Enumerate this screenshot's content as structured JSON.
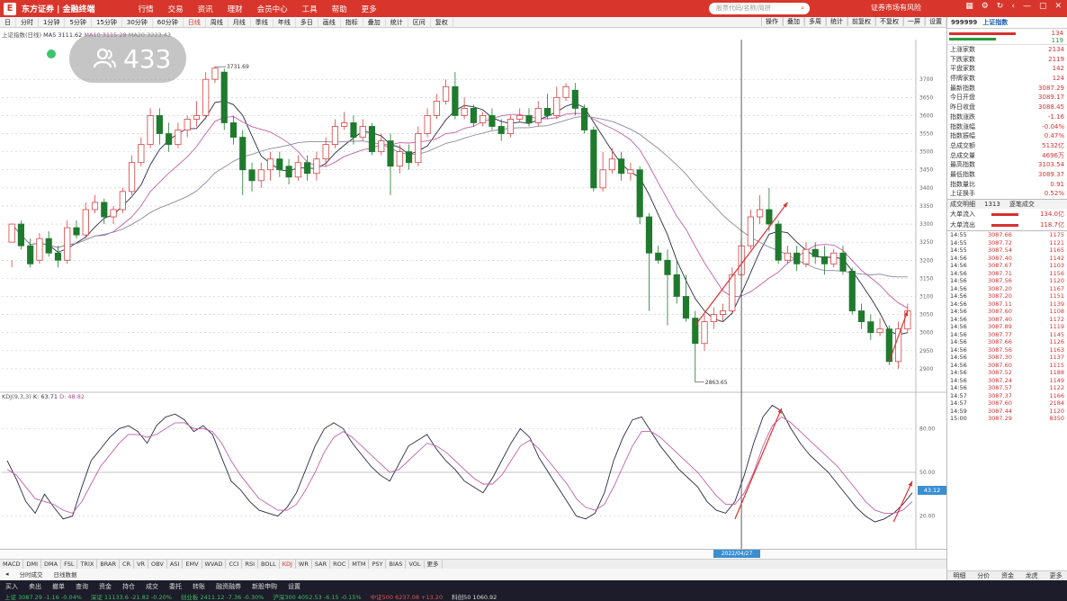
{
  "titlebar": {
    "logo": "E",
    "brand": "东方证券 | 金融终端",
    "menu": [
      "行情",
      "交易",
      "资讯",
      "理财",
      "会员中心",
      "工具",
      "帮助",
      "更多"
    ],
    "search_placeholder": "股票代码/名称/简拼",
    "market_note": "证券市场有风险",
    "icons": [
      "grid-icon",
      "settings-icon",
      "refresh-icon",
      "back-icon",
      "minimize-icon",
      "maximize-icon",
      "close-icon"
    ]
  },
  "toolbar": {
    "items": [
      "日",
      "分时",
      "1分钟",
      "5分钟",
      "15分钟",
      "30分钟",
      "60分钟",
      "日线",
      "周线",
      "月线",
      "季线",
      "年线",
      "多日",
      "画线",
      "指标",
      "叠加",
      "统计",
      "区间",
      "复权"
    ],
    "active_index": 7,
    "right": [
      "操作",
      "叠加",
      "多周",
      "统计",
      "前复权",
      "不复权",
      "一屏",
      "设置"
    ]
  },
  "infoline": {
    "name": "上证指数(日线)",
    "ma5": "MA5 3111.62",
    "ma10": "MA10 3115.28",
    "ma20": "MA20 3223.43"
  },
  "viewer": {
    "count": "433"
  },
  "chart_labels": {
    "high": "3731.69",
    "low": "2863.65"
  },
  "chart_data": {
    "type": "candlestick",
    "note": "price chart with KDJ subchart",
    "ylim": [
      2850,
      3800
    ],
    "yticks": [
      2900,
      2950,
      3000,
      3050,
      3100,
      3150,
      3200,
      3250,
      3300,
      3350,
      3400,
      3450,
      3500,
      3550,
      3600,
      3650,
      3700
    ],
    "candles": [
      [
        3250,
        3300,
        3200,
        3180
      ],
      [
        3300,
        3240,
        3310,
        3230
      ],
      [
        3240,
        3190,
        3260,
        3180
      ],
      [
        3200,
        3260,
        3275,
        3190
      ],
      [
        3260,
        3220,
        3280,
        3210
      ],
      [
        3220,
        3200,
        3240,
        3180
      ],
      [
        3200,
        3290,
        3310,
        3190
      ],
      [
        3290,
        3270,
        3310,
        3260
      ],
      [
        3270,
        3340,
        3360,
        3260
      ],
      [
        3340,
        3360,
        3380,
        3330
      ],
      [
        3360,
        3320,
        3370,
        3300
      ],
      [
        3320,
        3340,
        3350,
        3300
      ],
      [
        3340,
        3390,
        3400,
        3330
      ],
      [
        3390,
        3470,
        3490,
        3380
      ],
      [
        3470,
        3520,
        3540,
        3460
      ],
      [
        3520,
        3600,
        3620,
        3510
      ],
      [
        3600,
        3550,
        3620,
        3520
      ],
      [
        3550,
        3520,
        3580,
        3500
      ],
      [
        3520,
        3560,
        3580,
        3510
      ],
      [
        3560,
        3590,
        3600,
        3540
      ],
      [
        3590,
        3600,
        3640,
        3570
      ],
      [
        3600,
        3700,
        3720,
        3590
      ],
      [
        3700,
        3731,
        3735,
        3690
      ],
      [
        3720,
        3580,
        3730,
        3560
      ],
      [
        3580,
        3540,
        3600,
        3520
      ],
      [
        3540,
        3450,
        3560,
        3380
      ],
      [
        3450,
        3420,
        3470,
        3390
      ],
      [
        3420,
        3450,
        3470,
        3400
      ],
      [
        3450,
        3480,
        3500,
        3420
      ],
      [
        3480,
        3450,
        3500,
        3430
      ],
      [
        3460,
        3430,
        3480,
        3410
      ],
      [
        3430,
        3470,
        3490,
        3420
      ],
      [
        3470,
        3440,
        3490,
        3420
      ],
      [
        3440,
        3480,
        3500,
        3420
      ],
      [
        3480,
        3520,
        3540,
        3460
      ],
      [
        3520,
        3570,
        3590,
        3510
      ],
      [
        3570,
        3580,
        3610,
        3560
      ],
      [
        3580,
        3540,
        3600,
        3520
      ],
      [
        3540,
        3570,
        3590,
        3530
      ],
      [
        3570,
        3500,
        3580,
        3490
      ],
      [
        3500,
        3530,
        3550,
        3490
      ],
      [
        3530,
        3460,
        3550,
        3380
      ],
      [
        3460,
        3500,
        3520,
        3440
      ],
      [
        3500,
        3470,
        3520,
        3450
      ],
      [
        3470,
        3550,
        3570,
        3460
      ],
      [
        3550,
        3600,
        3620,
        3540
      ],
      [
        3600,
        3640,
        3660,
        3590
      ],
      [
        3640,
        3680,
        3700,
        3630
      ],
      [
        3680,
        3600,
        3720,
        3590
      ],
      [
        3600,
        3620,
        3650,
        3590
      ],
      [
        3620,
        3580,
        3630,
        3570
      ],
      [
        3580,
        3600,
        3610,
        3570
      ],
      [
        3600,
        3570,
        3620,
        3560
      ],
      [
        3570,
        3550,
        3590,
        3530
      ],
      [
        3550,
        3590,
        3600,
        3540
      ],
      [
        3590,
        3600,
        3620,
        3580
      ],
      [
        3600,
        3580,
        3620,
        3570
      ],
      [
        3580,
        3620,
        3640,
        3570
      ],
      [
        3620,
        3600,
        3660,
        3590
      ],
      [
        3600,
        3650,
        3680,
        3590
      ],
      [
        3650,
        3680,
        3690,
        3640
      ],
      [
        3670,
        3620,
        3690,
        3600
      ],
      [
        3620,
        3560,
        3630,
        3550
      ],
      [
        3560,
        3400,
        3570,
        3390
      ],
      [
        3400,
        3450,
        3500,
        3390
      ],
      [
        3450,
        3480,
        3510,
        3440
      ],
      [
        3480,
        3440,
        3500,
        3420
      ],
      [
        3440,
        3450,
        3470,
        3420
      ],
      [
        3450,
        3320,
        3460,
        3300
      ],
      [
        3320,
        3220,
        3330,
        3060
      ],
      [
        3220,
        3200,
        3240,
        3190
      ],
      [
        3200,
        3160,
        3230,
        3020
      ],
      [
        3160,
        3100,
        3200,
        3080
      ],
      [
        3100,
        3040,
        3160,
        3030
      ],
      [
        3040,
        2970,
        3060,
        2863
      ],
      [
        2970,
        3030,
        3050,
        2950
      ],
      [
        3030,
        3050,
        3070,
        3010
      ],
      [
        3050,
        3060,
        3080,
        3030
      ],
      [
        3060,
        3160,
        3180,
        3050
      ],
      [
        3160,
        3240,
        3260,
        3150
      ],
      [
        3240,
        3320,
        3340,
        3230
      ],
      [
        3320,
        3340,
        3380,
        3300
      ],
      [
        3340,
        3300,
        3400,
        3280
      ],
      [
        3300,
        3200,
        3310,
        3190
      ],
      [
        3200,
        3220,
        3240,
        3190
      ],
      [
        3220,
        3190,
        3240,
        3170
      ],
      [
        3190,
        3230,
        3250,
        3180
      ],
      [
        3230,
        3210,
        3250,
        3190
      ],
      [
        3210,
        3190,
        3240,
        3160
      ],
      [
        3190,
        3220,
        3230,
        3180
      ],
      [
        3220,
        3170,
        3240,
        3160
      ],
      [
        3170,
        3060,
        3180,
        3050
      ],
      [
        3060,
        3030,
        3080,
        3010
      ],
      [
        3030,
        3000,
        3050,
        2980
      ],
      [
        3000,
        3010,
        3040,
        2990
      ],
      [
        3010,
        2920,
        3020,
        2910
      ],
      [
        2920,
        3010,
        3030,
        2900
      ],
      [
        3010,
        3060,
        3080,
        3000
      ]
    ],
    "kdj_ylim": [
      0,
      100
    ],
    "kdj_yticks": [
      20,
      50,
      80
    ],
    "kdj_k": [
      58,
      45,
      30,
      22,
      35,
      26,
      18,
      20,
      40,
      58,
      66,
      74,
      80,
      82,
      78,
      70,
      82,
      88,
      90,
      86,
      78,
      82,
      76,
      60,
      44,
      38,
      30,
      24,
      22,
      20,
      26,
      36,
      52,
      68,
      80,
      84,
      80,
      70,
      62,
      54,
      48,
      44,
      56,
      68,
      72,
      76,
      66,
      58,
      52,
      44,
      40,
      36,
      46,
      58,
      70,
      80,
      74,
      60,
      50,
      40,
      30,
      20,
      18,
      22,
      36,
      58,
      74,
      86,
      88,
      78,
      68,
      60,
      52,
      46,
      40,
      30,
      24,
      22,
      30,
      48,
      70,
      88,
      96,
      92,
      80,
      70,
      62,
      56,
      50,
      42,
      34,
      26,
      20,
      16,
      18,
      22,
      28,
      36
    ],
    "kdj_d": [
      52,
      48,
      40,
      32,
      30,
      28,
      24,
      22,
      30,
      42,
      54,
      62,
      70,
      76,
      76,
      74,
      76,
      80,
      84,
      84,
      80,
      80,
      78,
      70,
      58,
      48,
      40,
      32,
      28,
      24,
      24,
      28,
      38,
      50,
      64,
      74,
      78,
      74,
      68,
      62,
      56,
      50,
      52,
      58,
      64,
      70,
      68,
      64,
      58,
      52,
      46,
      42,
      42,
      48,
      58,
      68,
      72,
      66,
      58,
      50,
      42,
      32,
      26,
      24,
      28,
      40,
      54,
      68,
      78,
      78,
      74,
      68,
      62,
      56,
      50,
      42,
      34,
      28,
      28,
      36,
      50,
      68,
      82,
      88,
      84,
      78,
      72,
      66,
      60,
      54,
      46,
      38,
      30,
      24,
      22,
      22,
      24,
      30
    ],
    "annotations": [
      "3731.69",
      "2863.65"
    ]
  },
  "kdj_label": {
    "title": "KDJ(9,3,3)",
    "k": "K: 63.71",
    "d": "D: 48.82"
  },
  "kdj_box": "43.12",
  "date_box": "2022/04/27",
  "indicators": [
    "MACD",
    "DMI",
    "DMA",
    "FSL",
    "TRIX",
    "BRAR",
    "CR",
    "VR",
    "OBV",
    "ASI",
    "EMV",
    "WVAD",
    "CCI",
    "RSI",
    "BOLL",
    "KDJ",
    "WR",
    "SAR",
    "ROC",
    "MTM",
    "PSY",
    "BIAS",
    "VOL",
    "更多"
  ],
  "tabs2": [
    "分时成交",
    "日线数据"
  ],
  "statusbar": {
    "row1": [
      "买入",
      "卖出",
      "撤单",
      "查询",
      "资金",
      "持仓",
      "成交",
      "委托",
      "转账",
      "融资融券",
      "新股申购",
      "设置"
    ],
    "row2": [
      "上证 3087.29 -1.16 -0.04%",
      "深证 11133.6 -21.82 -0.20%",
      "创业板 2411.12 -7.36 -0.30%",
      "沪深300 4052.53 -6.15 -0.15%",
      "中证500 6237.08 +13.20",
      "科创50 1060.92"
    ]
  },
  "right_panel": {
    "symbol": "999999",
    "name": "上证指数",
    "bar_top": "134",
    "bar_bottom": "119",
    "rows": [
      {
        "k": "上涨家数",
        "v": "2134"
      },
      {
        "k": "下跌家数",
        "v": "2119"
      },
      {
        "k": "平盘家数",
        "v": "142"
      },
      {
        "k": "停牌家数",
        "v": "124"
      },
      {
        "k": "最新指数",
        "v": "3087.29"
      },
      {
        "k": "今日开盘",
        "v": "3089.17"
      },
      {
        "k": "昨日收盘",
        "v": "3088.45"
      },
      {
        "k": "指数涨跌",
        "v": "-1.16"
      },
      {
        "k": "指数涨幅",
        "v": "-0.04%"
      },
      {
        "k": "指数振幅",
        "v": "0.47%"
      },
      {
        "k": "总成交额",
        "v": "5132亿"
      },
      {
        "k": "总成交量",
        "v": "4696万"
      },
      {
        "k": "最高指数",
        "v": "3103.54"
      },
      {
        "k": "最低指数",
        "v": "3089.37"
      },
      {
        "k": "指数量比",
        "v": "0.91"
      },
      {
        "k": "上证换手",
        "v": "0.52%"
      }
    ],
    "hdr": [
      "成交明细",
      "1313",
      "逐笔成交"
    ],
    "flows": [
      {
        "k": "大单流入",
        "v": "134.0亿"
      },
      {
        "k": "大单流出",
        "v": "118.7亿"
      }
    ],
    "ticks": [
      [
        "14:55",
        "3087.66",
        "1175"
      ],
      [
        "14:55",
        "3087.72",
        "1121"
      ],
      [
        "14:55",
        "3087.54",
        "1165"
      ],
      [
        "14:56",
        "3087.40",
        "1142"
      ],
      [
        "14:56",
        "3087.67",
        "1103"
      ],
      [
        "14:56",
        "3087.71",
        "1156"
      ],
      [
        "14:56",
        "3087.56",
        "1120"
      ],
      [
        "14:56",
        "3087.20",
        "1167"
      ],
      [
        "14:56",
        "3087.20",
        "1151"
      ],
      [
        "14:56",
        "3087.11",
        "1139"
      ],
      [
        "14:56",
        "3087.60",
        "1108"
      ],
      [
        "14:56",
        "3087.40",
        "1172"
      ],
      [
        "14:56",
        "3087.89",
        "1119"
      ],
      [
        "14:56",
        "3087.77",
        "1145"
      ],
      [
        "14:56",
        "3087.66",
        "1126"
      ],
      [
        "14:56",
        "3087.56",
        "1163"
      ],
      [
        "14:56",
        "3087.30",
        "1137"
      ],
      [
        "14:56",
        "3087.60",
        "1115"
      ],
      [
        "14:56",
        "3087.52",
        "1188"
      ],
      [
        "14:56",
        "3087.24",
        "1149"
      ],
      [
        "14:56",
        "3087.57",
        "1122"
      ],
      [
        "14:57",
        "3087.37",
        "1166"
      ],
      [
        "14:57",
        "3087.60",
        "2184"
      ],
      [
        "14:59",
        "3087.44",
        "1120"
      ],
      [
        "15:00",
        "3087.29",
        "8350"
      ]
    ],
    "footer": [
      "明细",
      "分价",
      "资金",
      "龙虎",
      "更多"
    ]
  }
}
